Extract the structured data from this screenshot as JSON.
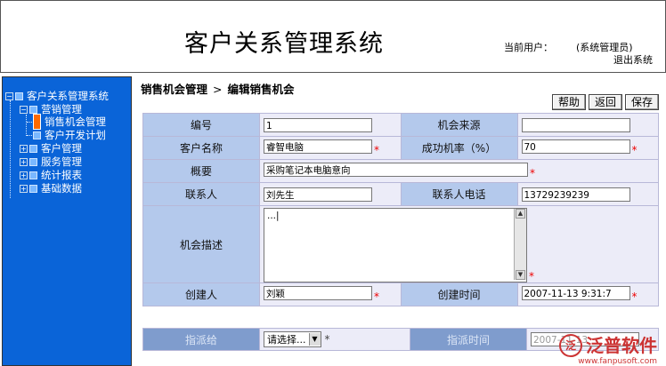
{
  "header": {
    "title": "客户关系管理系统",
    "current_user_label": "当前用户：",
    "current_user": "(系统管理员)",
    "logout": "退出系统"
  },
  "sidebar": {
    "root": "客户关系管理系统",
    "groups": [
      {
        "label": "营销管理",
        "expanded": true,
        "children": [
          "销售机会管理",
          "客户开发计划"
        ]
      },
      {
        "label": "客户管理",
        "expanded": false
      },
      {
        "label": "服务管理",
        "expanded": false
      },
      {
        "label": "统计报表",
        "expanded": false
      },
      {
        "label": "基础数据",
        "expanded": false
      }
    ],
    "selected": "销售机会管理"
  },
  "breadcrumb": {
    "section": "销售机会管理",
    "separator": ">",
    "page": "编辑销售机会"
  },
  "toolbar": {
    "help": "帮助",
    "back": "返回",
    "save": "保存"
  },
  "form": {
    "id_label": "编号",
    "id_value": "1",
    "source_label": "机会来源",
    "source_value": "",
    "customer_label": "客户名称",
    "customer_value": "睿智电脑",
    "rate_label": "成功机率（%）",
    "rate_value": "70",
    "summary_label": "概要",
    "summary_value": "采购笔记本电脑意向",
    "contact_label": "联系人",
    "contact_value": "刘先生",
    "phone_label": "联系人电话",
    "phone_value": "13729239239",
    "desc_label": "机会描述",
    "desc_value": "...|",
    "creator_label": "创建人",
    "creator_value": "刘颖",
    "created_label": "创建时间",
    "created_value": "2007-11-13 9:31:7",
    "required_mark": "*"
  },
  "assign": {
    "assignee_label": "指派给",
    "assignee_value": "请选择...",
    "assign_time_label": "指派时间",
    "assign_time_value": "2007-11-13",
    "mark": "*"
  },
  "watermark": {
    "logo_char": "泛",
    "brand": "泛普软件",
    "url": "www.fanpusoft.com"
  }
}
